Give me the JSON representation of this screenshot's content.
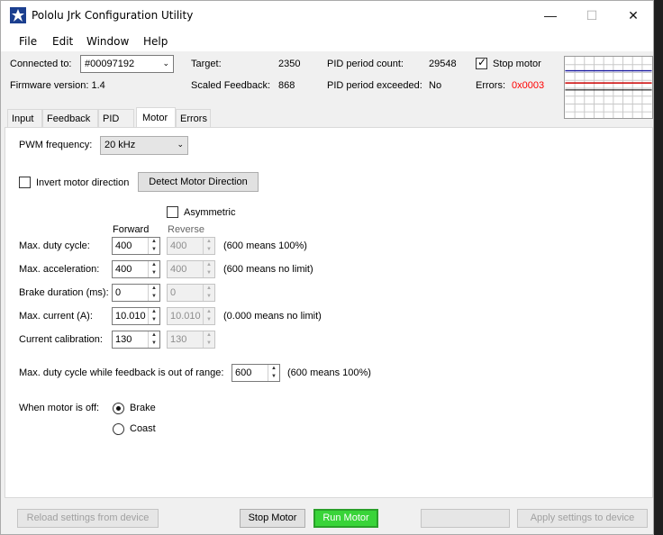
{
  "window": {
    "title": "Pololu Jrk Configuration Utility"
  },
  "menu": [
    "File",
    "Edit",
    "Window",
    "Help"
  ],
  "status": {
    "connected_label": "Connected to:",
    "device_value": "#00097192",
    "firmware_label": "Firmware version: 1.4",
    "target_label": "Target:",
    "target_value": "2350",
    "scaled_feedback_label": "Scaled Feedback:",
    "scaled_feedback_value": "868",
    "pid_count_label": "PID period count:",
    "pid_count_value": "29548",
    "pid_exceeded_label": "PID period exceeded:",
    "pid_exceeded_value": "No",
    "stop_motor_label": "Stop motor",
    "stop_motor_checked": true,
    "errors_label": "Errors:",
    "errors_value": "0x0003",
    "error_color": "#ff0000"
  },
  "tabs": [
    "Input",
    "Feedback",
    "PID",
    "Motor",
    "Errors"
  ],
  "active_tab": "Motor",
  "motor": {
    "pwm_label": "PWM frequency:",
    "pwm_value": "20 kHz",
    "invert_label": "Invert motor direction",
    "detect_button": "Detect Motor Direction",
    "asymmetric_label": "Asymmetric",
    "forward_header": "Forward",
    "reverse_header": "Reverse",
    "rows": [
      {
        "label": "Max. duty cycle:",
        "forward": "400",
        "reverse": "400",
        "note": "(600 means 100%)"
      },
      {
        "label": "Max. acceleration:",
        "forward": "400",
        "reverse": "400",
        "note": "(600 means no limit)"
      },
      {
        "label": "Brake duration (ms):",
        "forward": "0",
        "reverse": "0",
        "note": ""
      },
      {
        "label": "Max. current (A):",
        "forward": "10.010",
        "reverse": "10.010",
        "note": "(0.000 means no limit)"
      },
      {
        "label": "Current calibration:",
        "forward": "130",
        "reverse": "130",
        "note": ""
      }
    ],
    "out_of_range_label": "Max. duty cycle while feedback is out of range:",
    "out_of_range_value": "600",
    "out_of_range_note": "(600 means 100%)",
    "motor_off_label": "When motor is off:",
    "brake_label": "Brake",
    "coast_label": "Coast",
    "motor_off_selected": "Brake"
  },
  "buttons": {
    "reload": "Reload settings from device",
    "stop": "Stop Motor",
    "run": "Run Motor",
    "apply": "Apply settings to device"
  },
  "colors": {
    "run_button": "#39d439",
    "graph_target": "#1a1aa0",
    "graph_feedback": "#cc0000"
  }
}
